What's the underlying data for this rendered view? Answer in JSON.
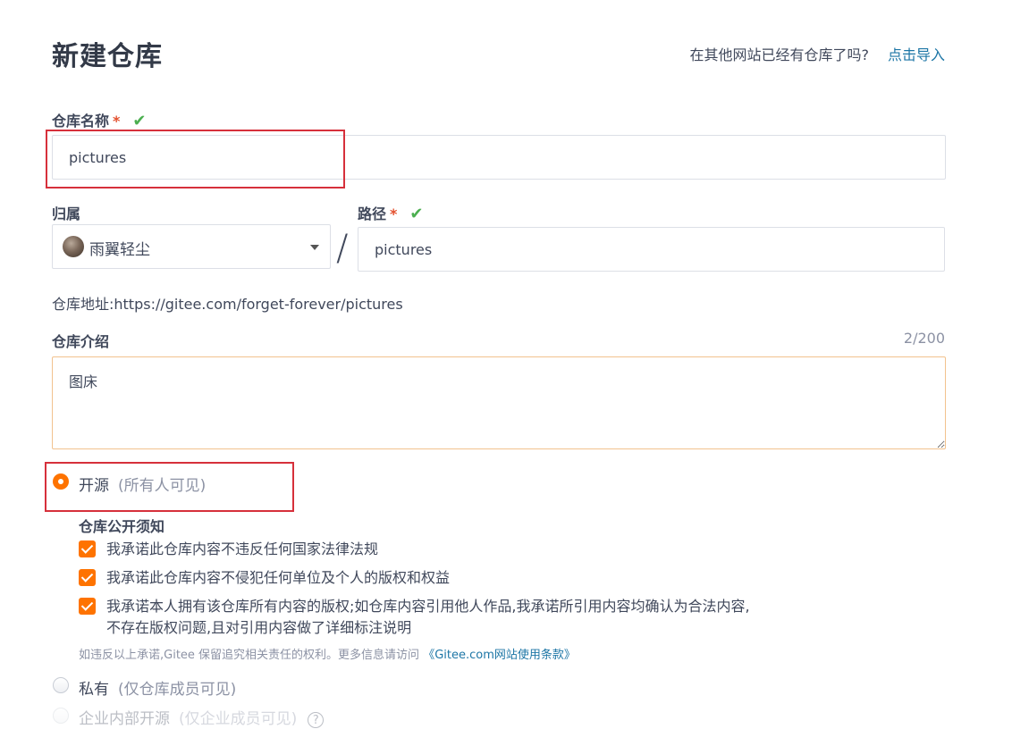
{
  "header": {
    "title": "新建仓库",
    "import_question": "在其他网站已经有仓库了吗?",
    "import_link": "点击导入"
  },
  "repo_name": {
    "label": "仓库名称",
    "required_mark": "*",
    "valid_icon": "✔",
    "value": "pictures"
  },
  "owner": {
    "label": "归属",
    "value": "雨翼轻尘",
    "separator": "/"
  },
  "path": {
    "label": "路径",
    "required_mark": "*",
    "valid_icon": "✔",
    "value": "pictures"
  },
  "repo_address": {
    "text": "仓库地址:https://gitee.com/forget-forever/pictures"
  },
  "description": {
    "label": "仓库介绍",
    "counter": "2/200",
    "value": "图床"
  },
  "visibility": {
    "public": {
      "label": "开源",
      "hint": "(所有人可见)",
      "selected": true
    },
    "public_notice_title": "仓库公开须知",
    "promises": [
      {
        "text": "我承诺此仓库内容不违反任何国家法律法规",
        "checked": true
      },
      {
        "text": "我承诺此仓库内容不侵犯任何单位及个人的版权和权益",
        "checked": true
      },
      {
        "text": "我承诺本人拥有该仓库所有内容的版权;如仓库内容引用他人作品,我承诺所引用内容均确认为合法内容,",
        "text2": "不存在版权问题,且对引用内容做了详细标注说明",
        "checked": true
      }
    ],
    "notice_text": "如违反以上承诺,Gitee 保留追究相关责任的权利。更多信息请访问",
    "notice_link": "《Gitee.com网站使用条款》",
    "private": {
      "label": "私有",
      "hint": "(仅仓库成员可见)",
      "selected": false
    },
    "enterprise": {
      "label": "企业内部开源",
      "hint": "(仅企业成员可见)",
      "help_icon": "?",
      "selected": false
    }
  },
  "colors": {
    "accent": "#fe7300",
    "link": "#1d76a6",
    "valid": "#4caf50",
    "required": "#e3512f",
    "highlight_box": "#d6303b"
  }
}
